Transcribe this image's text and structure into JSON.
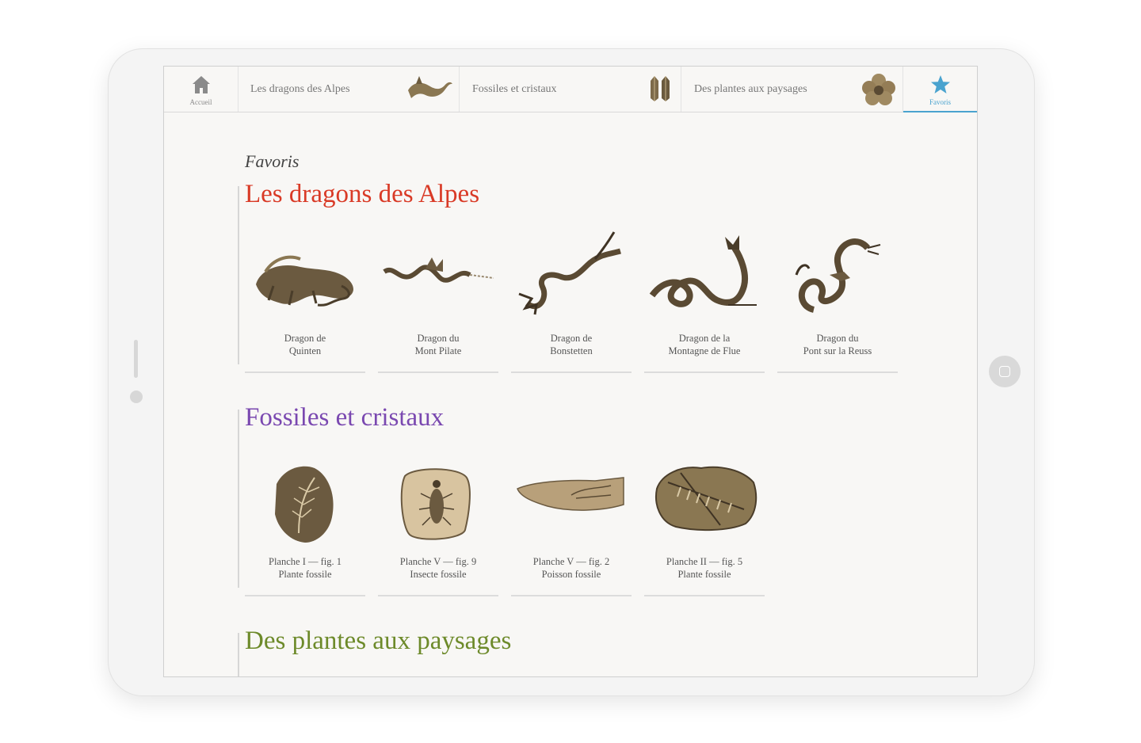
{
  "nav": {
    "home_label": "Accueil",
    "favorites_label": "Favoris",
    "tabs": [
      {
        "label": "Les dragons des Alpes",
        "icon": "dragon-icon"
      },
      {
        "label": "Fossiles et cristaux",
        "icon": "crystal-icon"
      },
      {
        "label": "Des plantes aux paysages",
        "icon": "flower-icon"
      }
    ],
    "active": "Favoris"
  },
  "page": {
    "title": "Favoris"
  },
  "sections": [
    {
      "title": "Les dragons des Alpes",
      "color": "#d93a26",
      "items": [
        {
          "line1": "Dragon de",
          "line2": "Quinten"
        },
        {
          "line1": "Dragon du",
          "line2": "Mont Pilate"
        },
        {
          "line1": "Dragon de",
          "line2": "Bonstetten"
        },
        {
          "line1": "Dragon de la",
          "line2": "Montagne de Flue"
        },
        {
          "line1": "Dragon du",
          "line2": "Pont sur la Reuss"
        }
      ]
    },
    {
      "title": "Fossiles et cristaux",
      "color": "#7a48b0",
      "items": [
        {
          "line1": "Planche I — fig. 1",
          "line2": "Plante fossile"
        },
        {
          "line1": "Planche V — fig. 9",
          "line2": "Insecte fossile"
        },
        {
          "line1": "Planche V — fig. 2",
          "line2": "Poisson fossile"
        },
        {
          "line1": "Planche II — fig. 5",
          "line2": "Plante fossile"
        }
      ]
    },
    {
      "title": "Des plantes aux paysages",
      "color": "#6d8a2a",
      "items": []
    }
  ],
  "colors": {
    "accent": "#4aa3cf",
    "engraving": "#5a4a33"
  }
}
